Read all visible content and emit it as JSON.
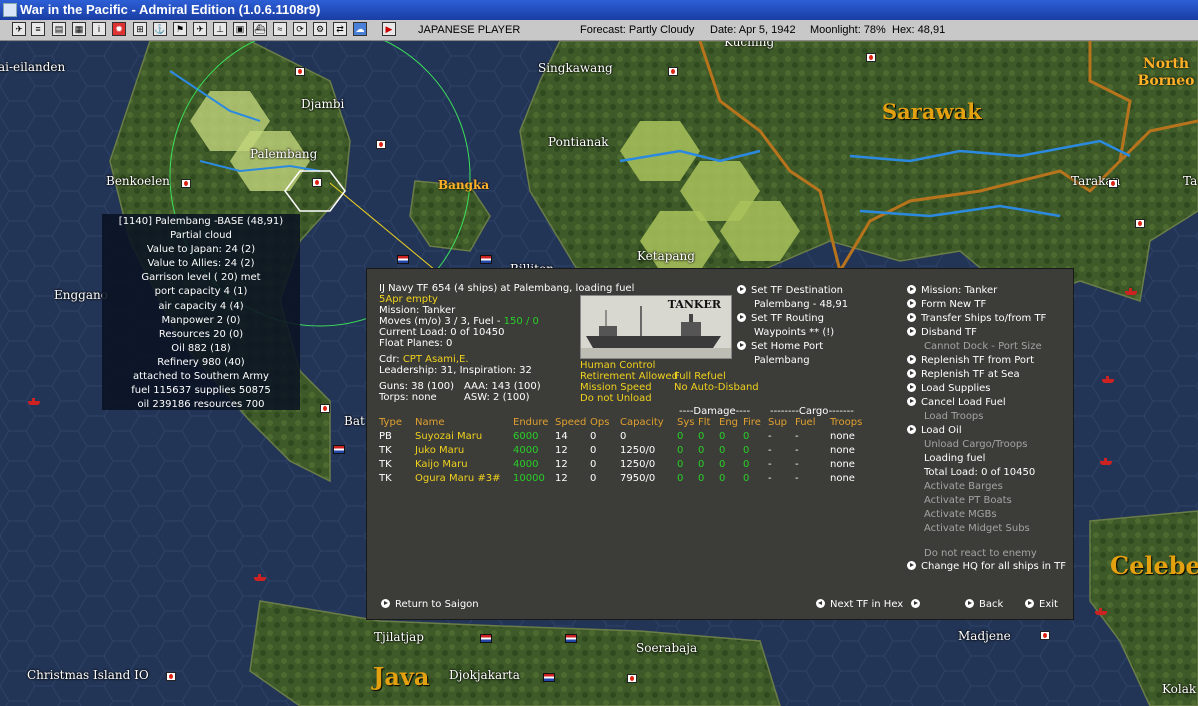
{
  "window": {
    "title": "War in the Pacific - Admiral Edition (1.0.6.1108r9)"
  },
  "toolbar": {
    "player": "JAPANESE PLAYER",
    "forecast": "Forecast: Partly Cloudy",
    "date": "Date: Apr 5, 1942",
    "moonlight": "Moonlight: 78%",
    "hex": "Hex: 48,91"
  },
  "map": {
    "places": {
      "ai_eilanden": "ai-eilanden",
      "djambi": "Djambi",
      "singkawang": "Singkawang",
      "kuching": "Kuching",
      "north_borneo": "North Borneo",
      "sarawak": "Sarawak",
      "pontianak": "Pontianak",
      "palembang": "Palembang",
      "benkoelen": "Benkoelen",
      "bangka": "Bangka",
      "tarakan": "Tarakan",
      "ta": "Ta",
      "ketapang": "Ketapang",
      "billiton": "Billiton",
      "enggano": "Enggano",
      "bat": "Bat",
      "tjilatjap": "Tjilatjap",
      "soerabaja": "Soerabaja",
      "djokjakarta": "Djokjakarta",
      "java": "Java",
      "christmas_island": "Christmas Island IO",
      "madjene": "Madjene",
      "celebes": "Celebe",
      "kolaka": "Kolak"
    }
  },
  "base_info": {
    "lines": [
      "[1140] Palembang -BASE (48,91)",
      "Partial cloud",
      "Value to Japan: 24 (2)",
      "Value to Allies: 24 (2)",
      "Garrison level ( 20) met",
      "port capacity 4 (1)",
      "air capacity 4 (4)",
      "Manpower 2 (0)",
      "Resources 20 (0)",
      "Oil 882 (18)",
      "Refinery 980 (40)",
      "attached to Southern Army",
      "fuel 115637 supplies 50875",
      "oil 239186 resources 700"
    ]
  },
  "tf": {
    "header": "IJ Navy TF 654 (4 ships) at Palembang, loading fuel",
    "status": "5Apr empty",
    "mission": "Mission: Tanker",
    "moves": "Moves (m/o) 3 / 3, Fuel -",
    "fuel": "150 / 0",
    "current_load": "Current Load: 0 of 10450",
    "float_planes": "Float Planes: 0",
    "cdr_label": "Cdr:",
    "cdr_name": "CPT Asami,E.",
    "leadership": "Leadership: 31, Inspiration: 32",
    "guns": "Guns: 38 (100)",
    "aaa": "AAA: 143 (100)",
    "torps": "Torps: none",
    "asw": "ASW: 2 (100)",
    "ship_image_label": "TANKER",
    "human_control": "Human Control",
    "retirement": "Retirement Allowed",
    "full_refuel": "Full Refuel",
    "mission_speed": "Mission Speed",
    "no_auto_disband": "No Auto-Disband",
    "do_not_unload": "Do not Unload",
    "destination": {
      "set_dest": "Set TF Destination",
      "dest_value": "Palembang - 48,91",
      "set_routing": "Set TF Routing",
      "waypoints": "Waypoints ** (!)",
      "set_home": "Set Home Port",
      "home_value": "Palembang"
    },
    "table": {
      "headers": [
        "Type",
        "Name",
        "Endure",
        "Speed",
        "Ops",
        "Capacity",
        "Sys",
        "Flt",
        "Eng",
        "Fire",
        "Sup",
        "Fuel",
        "Troops"
      ],
      "damage_group": "----Damage----",
      "cargo_group": "--------Cargo-------",
      "rows": [
        {
          "type": "PB",
          "name": "Suyozai Maru",
          "endure": "6000",
          "speed": "14",
          "ops": "0",
          "capacity": "0",
          "sys": "0",
          "flt": "0",
          "eng": "0",
          "fire": "0",
          "sup": "-",
          "fuel": "-",
          "troops": "none"
        },
        {
          "type": "TK",
          "name": "Juko Maru",
          "endure": "4000",
          "speed": "12",
          "ops": "0",
          "capacity": "1250/0",
          "sys": "0",
          "flt": "0",
          "eng": "0",
          "fire": "0",
          "sup": "-",
          "fuel": "-",
          "troops": "none"
        },
        {
          "type": "TK",
          "name": "Kaijo Maru",
          "endure": "4000",
          "speed": "12",
          "ops": "0",
          "capacity": "1250/0",
          "sys": "0",
          "flt": "0",
          "eng": "0",
          "fire": "0",
          "sup": "-",
          "fuel": "-",
          "troops": "none"
        },
        {
          "type": "TK",
          "name": "Ogura Maru #3#",
          "endure": "10000",
          "speed": "12",
          "ops": "0",
          "capacity": "7950/0",
          "sys": "0",
          "flt": "0",
          "eng": "0",
          "fire": "0",
          "sup": "-",
          "fuel": "-",
          "troops": "none"
        }
      ]
    },
    "actions": [
      {
        "label": "Mission: Tanker",
        "enabled": true,
        "bullet": true
      },
      {
        "label": "Form New TF",
        "enabled": true,
        "bullet": true
      },
      {
        "label": "Transfer Ships to/from TF",
        "enabled": true,
        "bullet": true
      },
      {
        "label": "Disband TF",
        "enabled": true,
        "bullet": true
      },
      {
        "label": "Cannot Dock - Port Size",
        "enabled": false,
        "bullet": false
      },
      {
        "label": "Replenish TF from Port",
        "enabled": true,
        "bullet": true
      },
      {
        "label": "Replenish TF at Sea",
        "enabled": true,
        "bullet": true
      },
      {
        "label": "Load Supplies",
        "enabled": true,
        "bullet": true
      },
      {
        "label": "Cancel Load Fuel",
        "enabled": true,
        "bullet": true
      },
      {
        "label": "Load Troops",
        "enabled": false,
        "bullet": false
      },
      {
        "label": "Load Oil",
        "enabled": true,
        "bullet": true
      },
      {
        "label": "Unload Cargo/Troops",
        "enabled": false,
        "bullet": false
      },
      {
        "label": "Loading fuel",
        "enabled": true,
        "bullet": false
      },
      {
        "label": "Total Load: 0 of 10450",
        "enabled": true,
        "bullet": false
      },
      {
        "label": "Activate Barges",
        "enabled": false,
        "bullet": false
      },
      {
        "label": "Activate PT Boats",
        "enabled": false,
        "bullet": false
      },
      {
        "label": "Activate MGBs",
        "enabled": false,
        "bullet": false
      },
      {
        "label": "Activate Midget Subs",
        "enabled": false,
        "bullet": false
      }
    ],
    "do_not_react": "Do not react to enemy",
    "change_hq": "Change HQ for all ships in TF",
    "footer": {
      "return": "Return to Saigon",
      "next_tf": "Next TF in Hex",
      "back": "Back",
      "exit": "Exit"
    }
  }
}
